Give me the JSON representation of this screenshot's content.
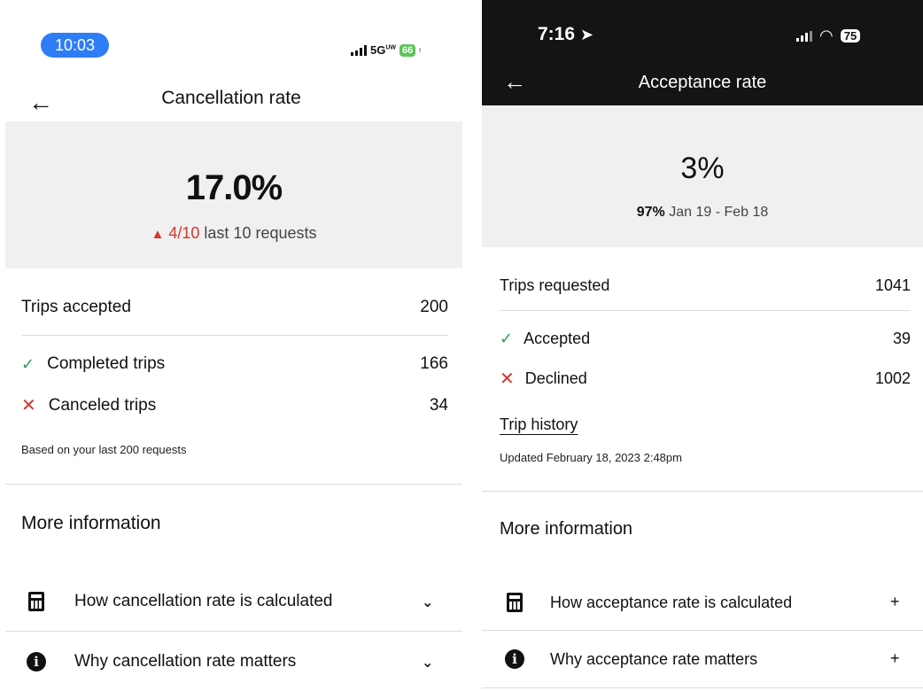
{
  "left": {
    "status": {
      "time": "10:03",
      "network": "5G",
      "network_suffix": "UW",
      "battery": "66"
    },
    "title": "Cancellation rate",
    "rate": "17.0%",
    "recent": {
      "fraction": "4/10",
      "text": "last 10 requests"
    },
    "summary": {
      "label": "Trips accepted",
      "value": "200"
    },
    "rows": [
      {
        "label": "Completed trips",
        "value": "166"
      },
      {
        "label": "Canceled trips",
        "value": "34"
      }
    ],
    "note": "Based on your last 200 requests",
    "more_title": "More information",
    "faq": [
      {
        "label": "How cancellation rate is calculated"
      },
      {
        "label": "Why cancellation rate matters"
      }
    ]
  },
  "right": {
    "status": {
      "time": "7:16",
      "battery": "75"
    },
    "title": "Acceptance rate",
    "rate": "3%",
    "period": {
      "pct": "97%",
      "range": "Jan 19 - Feb 18"
    },
    "summary": {
      "label": "Trips requested",
      "value": "1041"
    },
    "rows": [
      {
        "label": "Accepted",
        "value": "39"
      },
      {
        "label": "Declined",
        "value": "1002"
      }
    ],
    "history_link": "Trip history",
    "updated": "Updated February 18, 2023 2:48pm",
    "more_title": "More information",
    "faq": [
      {
        "label": "How acceptance rate is calculated"
      },
      {
        "label": "Why acceptance rate matters"
      }
    ]
  },
  "colors": {
    "accent_red": "#d6342c",
    "check_green": "#2f9b5a",
    "status_blue": "#2f7df6",
    "header_dark": "#141414"
  }
}
